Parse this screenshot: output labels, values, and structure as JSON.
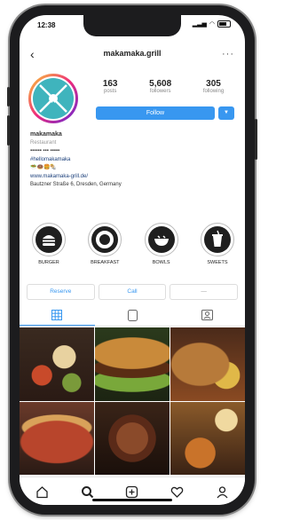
{
  "status": {
    "time": "12:38"
  },
  "header": {
    "username": "makamaka.grill"
  },
  "profile": {
    "stats": [
      {
        "value": "163",
        "label": "posts"
      },
      {
        "value": "5,608",
        "label": "followers"
      },
      {
        "value": "305",
        "label": "following"
      }
    ],
    "follow_label": "Follow",
    "name": "makamaka",
    "category": "Restaurant",
    "bio_emoji_line": "▪▪▪▪▪▪ ▪▪▪ ▪▪▪▪▪",
    "hashtag": "#hellomakamaka",
    "emoji_line": "🥗🍩🍔🌯",
    "website": "www.makamaka-grill.de/",
    "address": "Bautzner Straße 6, Dresden, Germany"
  },
  "highlights": [
    {
      "label": "BURGER",
      "icon": "burger-icon"
    },
    {
      "label": "BREAKFAST",
      "icon": "donut-icon"
    },
    {
      "label": "BOWLS",
      "icon": "bowl-icon"
    },
    {
      "label": "SWEETS",
      "icon": "cup-icon"
    }
  ],
  "actions": {
    "reserve": "Reserve",
    "call": "Call"
  },
  "colors": {
    "accent": "#3897f0",
    "avatar_bg": "#3fb4bd"
  }
}
